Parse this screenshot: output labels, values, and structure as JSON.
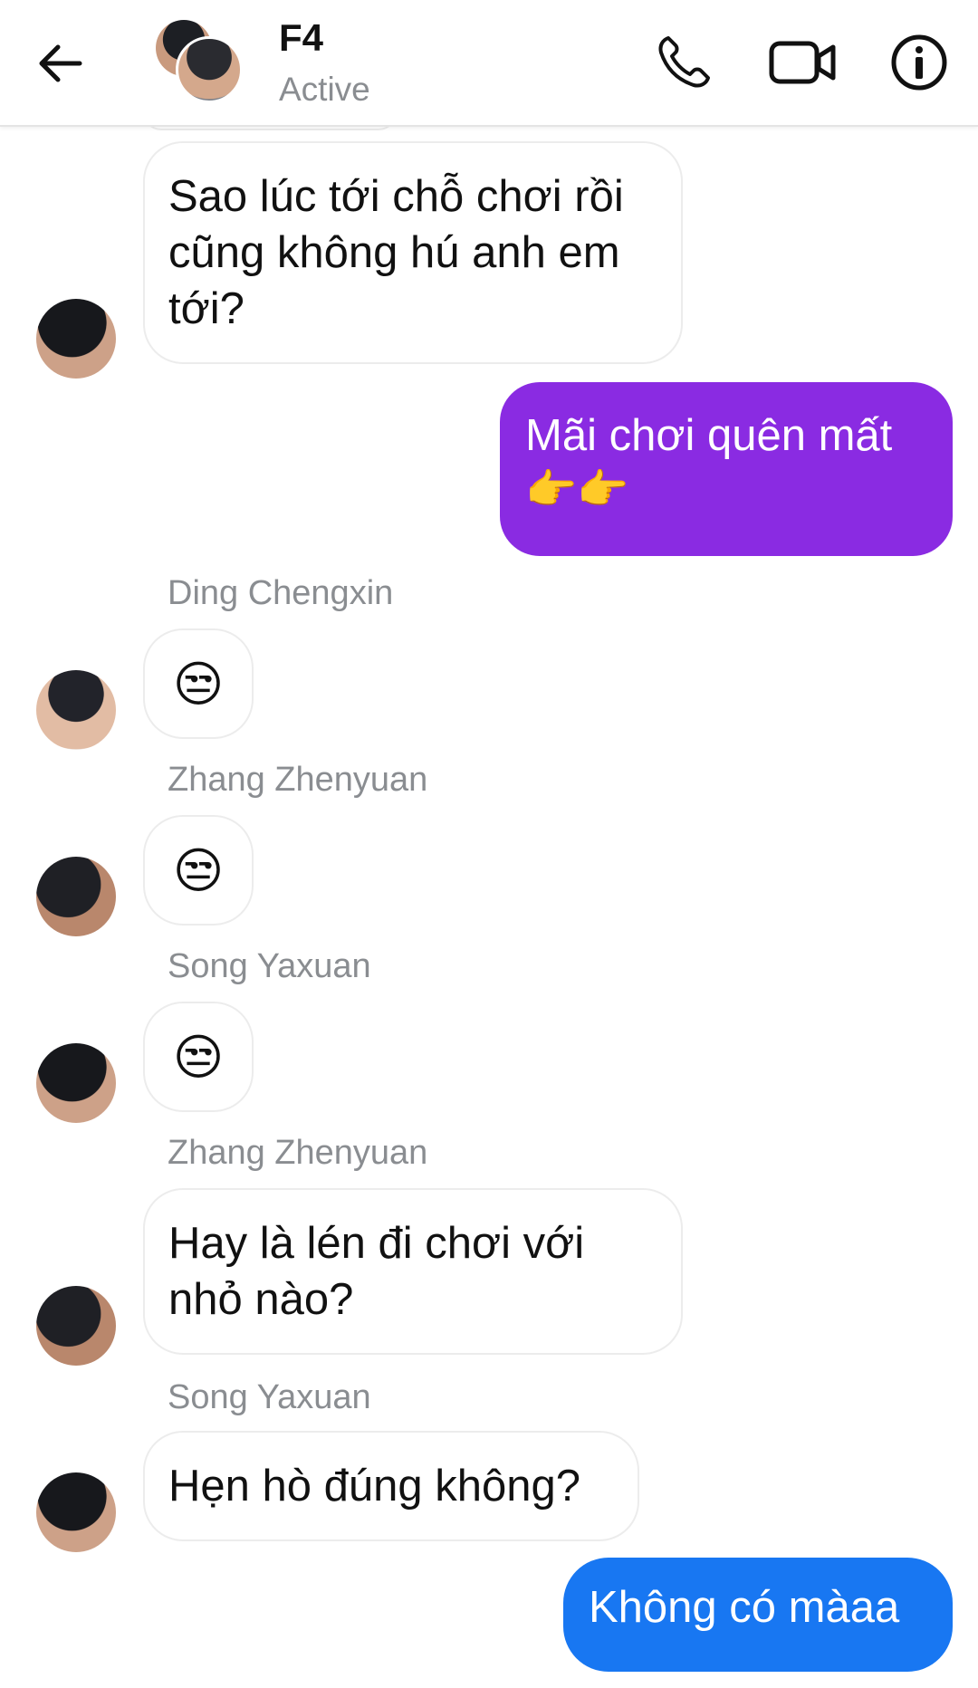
{
  "header": {
    "back_icon": "arrow-left-icon",
    "title": "F4",
    "status": "Active",
    "icons": [
      "phone-icon",
      "video-camera-icon",
      "info-icon"
    ]
  },
  "messages": [
    {
      "type": "incoming",
      "text": "Sao lúc tới chỗ chơi rồi cũng không hú anh em tới?"
    },
    {
      "type": "outgoing",
      "text": "Mãi chơi quên mất",
      "emoji": "👉👉"
    },
    {
      "type": "incoming",
      "sender": "Ding Chengxin",
      "emoji": "😒"
    },
    {
      "type": "incoming",
      "sender": "Zhang Zhenyuan",
      "emoji": "😒"
    },
    {
      "type": "incoming",
      "sender": "Song Yaxuan",
      "emoji": "😒"
    },
    {
      "type": "incoming",
      "sender": "Zhang Zhenyuan",
      "text": "Hay là lén đi chơi với nhỏ nào?"
    },
    {
      "type": "incoming",
      "sender": "Song Yaxuan",
      "text": "Hẹn hò đúng không?"
    },
    {
      "type": "outgoing",
      "text": "Không có màaa"
    }
  ],
  "colors": {
    "outgoing_purple": "#8a2be2",
    "outgoing_blue": "#1877f2",
    "secondary_text": "#8a8d91"
  }
}
